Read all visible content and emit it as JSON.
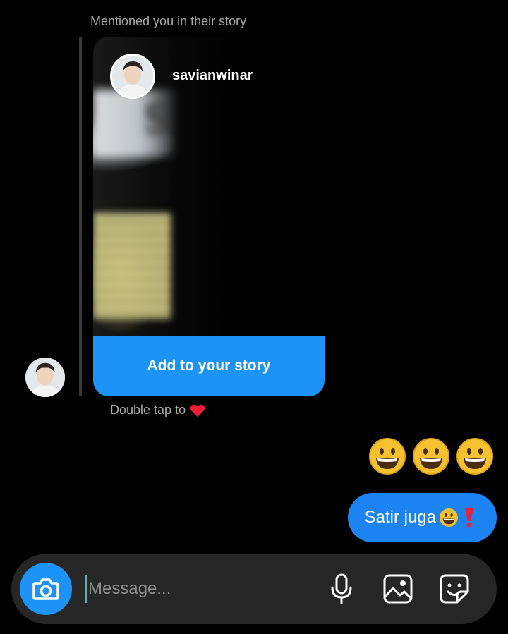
{
  "thread": {
    "mention_label": "Mentioned you in their story",
    "story": {
      "username": "savianwinar",
      "button_label": "Add to your story"
    },
    "hint_text": "Double tap to",
    "hint_icon": "heart-icon",
    "emoji_message": {
      "icon": "grinning-face-icon",
      "count": 3
    },
    "sent_message": {
      "text": "Satir juga",
      "icons": [
        "grinning-face-icon",
        "red-exclamation-icon"
      ]
    }
  },
  "composer": {
    "placeholder": "Message...",
    "icons": [
      "camera-icon",
      "microphone-icon",
      "gallery-icon",
      "sticker-icon"
    ]
  },
  "colors": {
    "accent": "#1c93f7",
    "sent_bubble": "#1c84f2",
    "background": "#000000",
    "composer": "#262626",
    "muted_text": "#a8a8a8"
  }
}
